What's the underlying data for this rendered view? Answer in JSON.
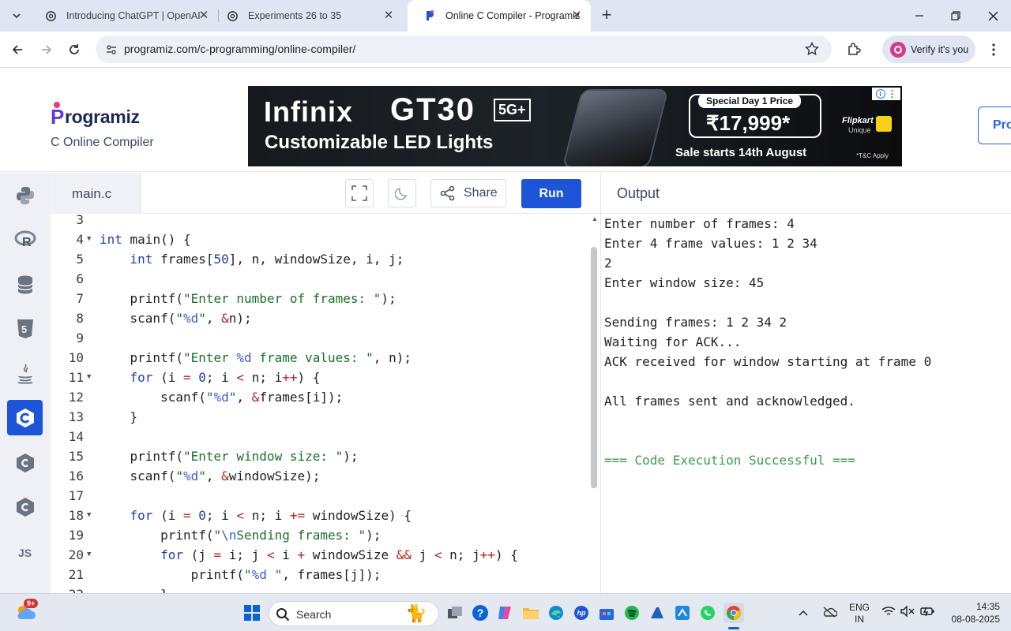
{
  "browser": {
    "tabs": [
      {
        "title": "Introducing ChatGPT | OpenAI",
        "icon": "openai-icon"
      },
      {
        "title": "Experiments 26 to 35",
        "icon": "openai-icon"
      },
      {
        "title": "Online C Compiler - Programiz",
        "icon": "programiz-icon",
        "active": true
      }
    ],
    "url": "programiz.com/c-programming/online-compiler/",
    "profile_label": "Verify it's you"
  },
  "site": {
    "logo_text": "rogramiz",
    "logo_p": "P",
    "subtitle": "C Online Compiler",
    "pro_button": "Pro"
  },
  "ad": {
    "brand": "Infinix",
    "model": "GT30",
    "badge": "5G+",
    "tagline": "Customizable LED Lights",
    "price_label": "Special Day 1 Price",
    "price": "₹17,999*",
    "sale_text": "Sale starts 14th August",
    "retailer": "Flipkart",
    "retailer_sub": "Unique",
    "fine_print": "*T&C Apply"
  },
  "editor": {
    "filename": "main.c",
    "share_label": "Share",
    "run_label": "Run"
  },
  "code_lines": [
    {
      "n": "3",
      "fold": false,
      "html": ""
    },
    {
      "n": "4",
      "fold": true,
      "html": "<span class='kw'>int</span> main() {"
    },
    {
      "n": "5",
      "fold": false,
      "html": "    <span class='kw'>int</span> frames[<span class='num'>50</span>], n, windowSize, i, j;"
    },
    {
      "n": "6",
      "fold": false,
      "html": ""
    },
    {
      "n": "7",
      "fold": false,
      "html": "    printf(<span class='str'>\"Enter number of frames: \"</span>);"
    },
    {
      "n": "8",
      "fold": false,
      "html": "    scanf(<span class='str'>\"<span class='fmt'>%d</span>\"</span>, <span class='op'>&amp;</span>n);"
    },
    {
      "n": "9",
      "fold": false,
      "html": ""
    },
    {
      "n": "10",
      "fold": false,
      "html": "    printf(<span class='str'>\"Enter <span class='fmt'>%d</span> frame values: \"</span>, n);"
    },
    {
      "n": "11",
      "fold": true,
      "html": "    <span class='kw'>for</span> (i <span class='op'>=</span> <span class='num'>0</span>; i <span class='op'>&lt;</span> n; i<span class='op'>++</span>) {"
    },
    {
      "n": "12",
      "fold": false,
      "html": "        scanf(<span class='str'>\"<span class='fmt'>%d</span>\"</span>, <span class='op'>&amp;</span>frames[i]);"
    },
    {
      "n": "13",
      "fold": false,
      "html": "    }"
    },
    {
      "n": "14",
      "fold": false,
      "html": ""
    },
    {
      "n": "15",
      "fold": false,
      "html": "    printf(<span class='str'>\"Enter window size: \"</span>);"
    },
    {
      "n": "16",
      "fold": false,
      "html": "    scanf(<span class='str'>\"<span class='fmt'>%d</span>\"</span>, <span class='op'>&amp;</span>windowSize);"
    },
    {
      "n": "17",
      "fold": false,
      "html": ""
    },
    {
      "n": "18",
      "fold": true,
      "html": "    <span class='kw'>for</span> (i <span class='op'>=</span> <span class='num'>0</span>; i <span class='op'>&lt;</span> n; i <span class='op'>+=</span> windowSize) {"
    },
    {
      "n": "19",
      "fold": false,
      "html": "        printf(<span class='str'>\"<span class='fmt'>\\n</span>Sending frames: \"</span>);"
    },
    {
      "n": "20",
      "fold": true,
      "html": "        <span class='kw'>for</span> (j <span class='op'>=</span> i; j <span class='op'>&lt;</span> i <span class='op'>+</span> windowSize <span class='op'>&amp;&amp;</span> j <span class='op'>&lt;</span> n; j<span class='op'>++</span>) {"
    },
    {
      "n": "21",
      "fold": false,
      "html": "            printf(<span class='str'>\"<span class='fmt'>%d</span> \"</span>, frames[j]);"
    },
    {
      "n": "22",
      "fold": false,
      "html": "        }"
    }
  ],
  "output": {
    "title": "Output",
    "lines": [
      "Enter number of frames: 4",
      "Enter 4 frame values: 1 2 34",
      "2",
      "Enter window size: 45",
      "",
      "Sending frames: 1 2 34 2",
      "Waiting for ACK...",
      "ACK received for window starting at frame 0",
      "",
      "All frames sent and acknowledged.",
      "",
      "",
      "=== Code Execution Successful ==="
    ]
  },
  "taskbar": {
    "search_placeholder": "Search",
    "weather_badge": "9+",
    "lang_top": "ENG",
    "lang_bottom": "IN",
    "time": "14:35",
    "date": "08-08-2025"
  },
  "colors": {
    "accent": "#1e55d8",
    "success_output": "#3f9a4c"
  }
}
